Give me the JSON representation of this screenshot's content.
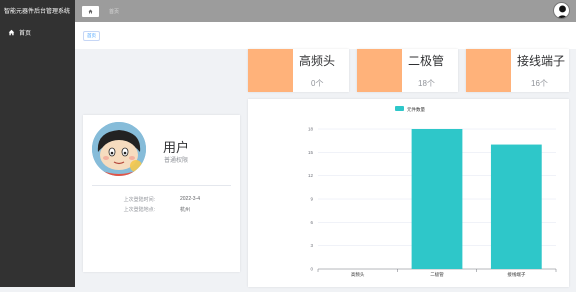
{
  "app": {
    "title": "智能元器件后台管理系统"
  },
  "sidebar": {
    "items": [
      {
        "label": "首页",
        "icon": "home-icon"
      }
    ]
  },
  "header": {
    "home_icon": "home-icon",
    "crumb": "首页",
    "avatar": "avatar"
  },
  "tags": [
    {
      "label": "首页"
    }
  ],
  "stats": [
    {
      "name": "高频头",
      "count": "0个",
      "color": "#ffb27a"
    },
    {
      "name": "二极管",
      "count": "18个",
      "color": "#ffb27a"
    },
    {
      "name": "接线端子",
      "count": "16个",
      "color": "#ffb27a"
    }
  ],
  "user": {
    "name": "用户",
    "role": "普通权限",
    "last_login_time_label": "上次登陆时间:",
    "last_login_time": "2022-3-4",
    "last_login_place_label": "上次登陆地点:",
    "last_login_place": "杭州"
  },
  "chart_data": {
    "type": "bar",
    "legend": [
      "元件数量"
    ],
    "legend_position": "top-center",
    "categories": [
      "高频头",
      "二极管",
      "接线端子"
    ],
    "series": [
      {
        "name": "元件数量",
        "values": [
          0,
          18,
          16
        ],
        "color": "#2ec7c9"
      }
    ],
    "yticks": [
      0,
      3,
      6,
      9,
      12,
      15,
      18
    ],
    "ylim": [
      0,
      18
    ],
    "grid": true
  }
}
